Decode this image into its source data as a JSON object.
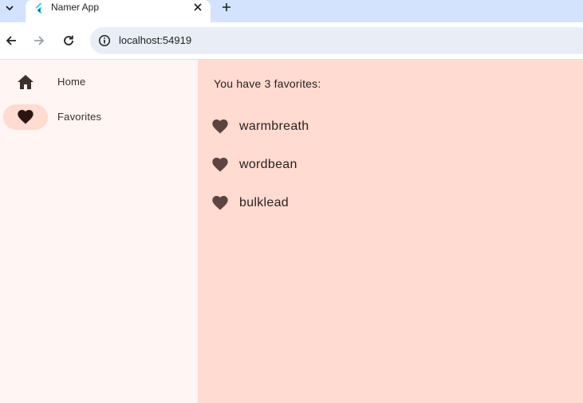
{
  "browser": {
    "tab": {
      "title": "Namer App"
    },
    "address_bar": {
      "url": "localhost:54919"
    },
    "colors": {
      "tabstrip": "#d3e3fd",
      "omnibox": "#e9edf6"
    }
  },
  "app": {
    "navigation_rail": {
      "items": [
        {
          "label": "Home",
          "icon": "home-icon",
          "selected": false
        },
        {
          "label": "Favorites",
          "icon": "heart-icon",
          "selected": true
        }
      ],
      "colors": {
        "background": "#fff5f3",
        "indicator": "#ffdbd1",
        "icon": "#3d2f2b",
        "selected_icon": "#2b1510"
      }
    },
    "favorites_page": {
      "count_text": "You have 3 favorites:",
      "favorites": [
        {
          "word": "warmbreath",
          "icon": "heart-icon"
        },
        {
          "word": "wordbean",
          "icon": "heart-icon"
        },
        {
          "word": "bulklead",
          "icon": "heart-icon"
        }
      ],
      "colors": {
        "background": "#ffdbd1",
        "icon": "#5c4541"
      }
    }
  }
}
